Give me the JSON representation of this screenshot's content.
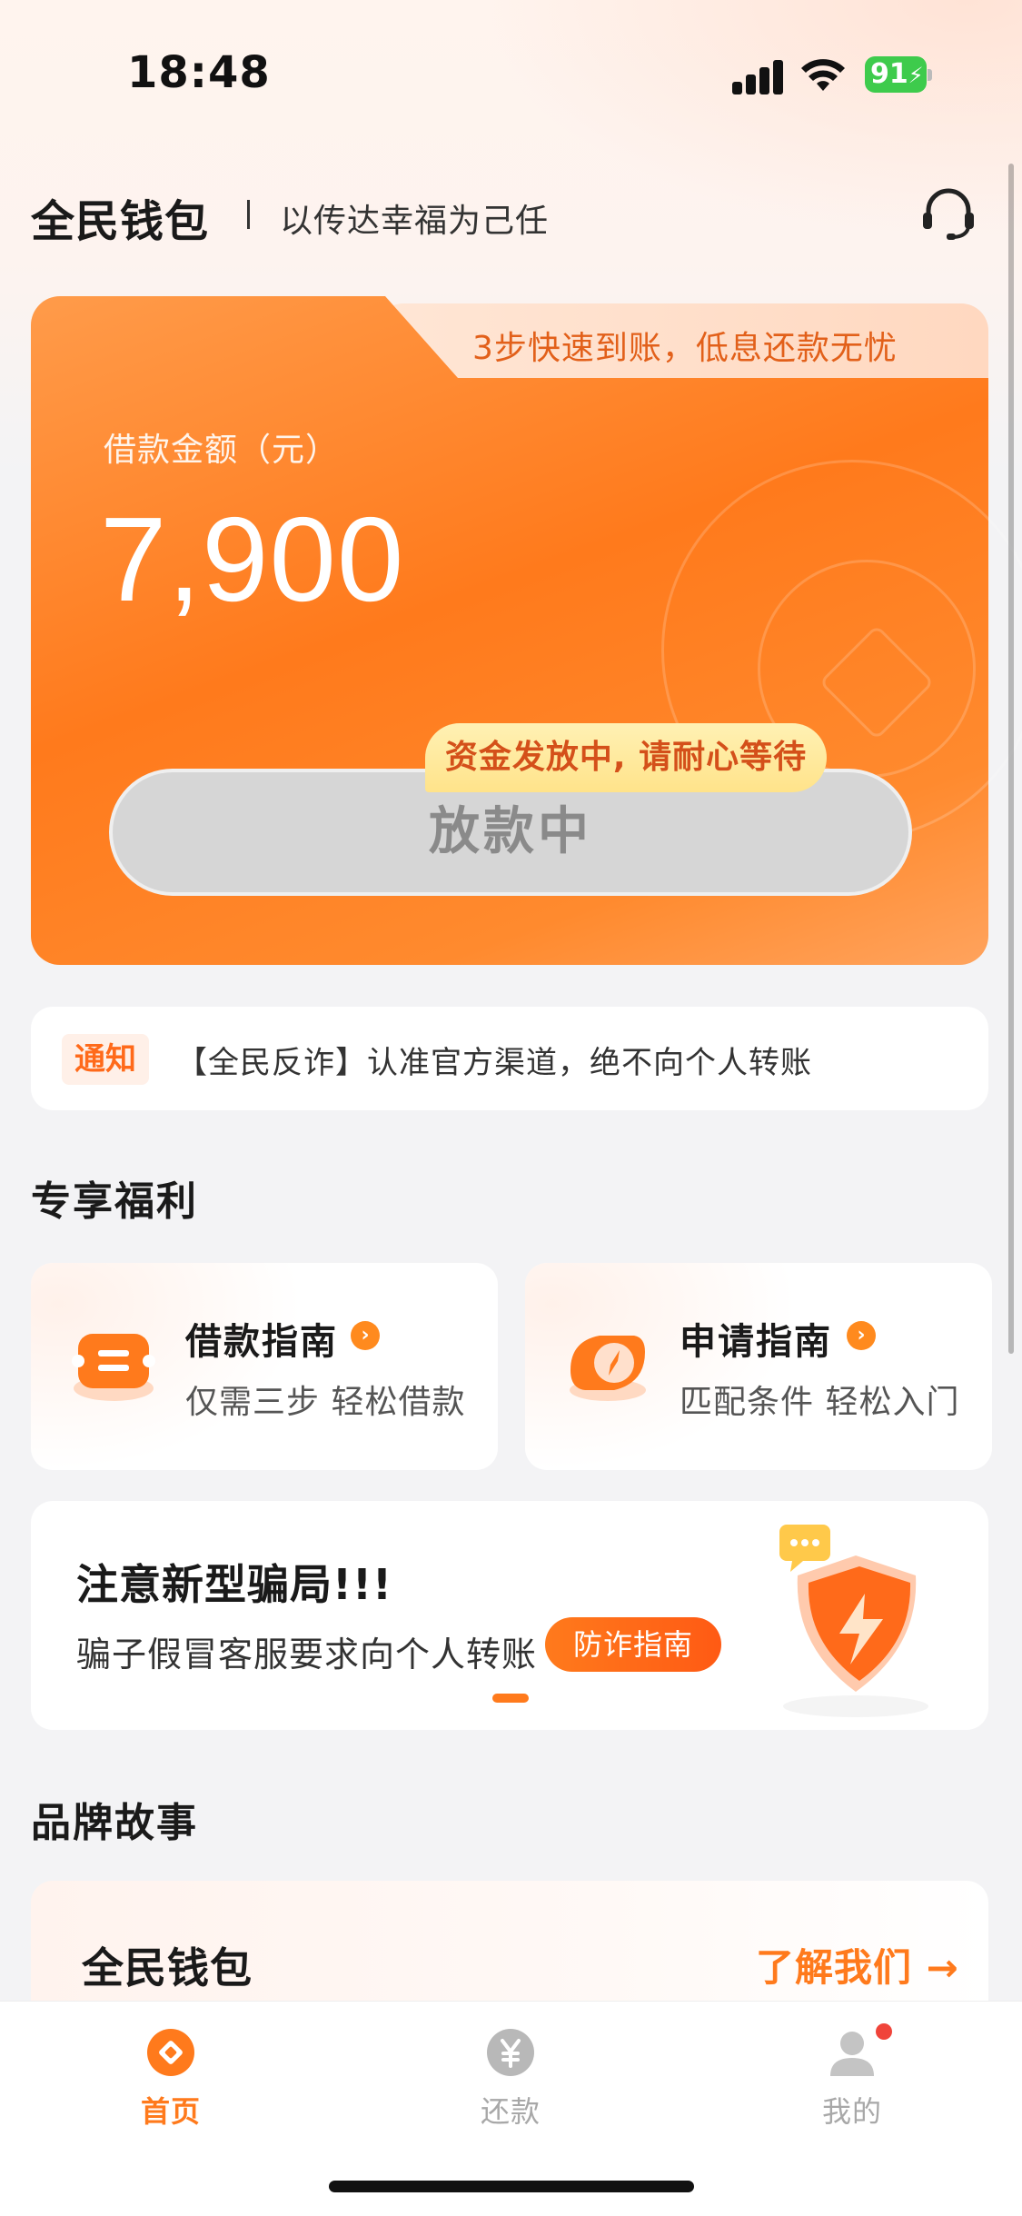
{
  "status_bar": {
    "time": "18:48",
    "battery": "91"
  },
  "header": {
    "brand": "全民钱包",
    "slogan": "以传达幸福为己任"
  },
  "loan_card": {
    "tagline": "3步快速到账，低息还款无忧",
    "amount_label": "借款金额（元）",
    "amount_value": "7,900",
    "status_tip": "资金发放中, 请耐心等待",
    "status_button": "放款中"
  },
  "notice": {
    "tag": "通知",
    "text": "【全民反诈】认准官方渠道，绝不向个人转账"
  },
  "benefits": {
    "title": "专享福利",
    "items": [
      {
        "title": "借款指南",
        "subtitle": "仅需三步  轻松借款"
      },
      {
        "title": "申请指南",
        "subtitle": "匹配条件  轻松入门"
      }
    ]
  },
  "banner": {
    "title": "注意新型骗局!!!",
    "subtitle": "骗子假冒客服要求向个人转账",
    "button": "防诈指南"
  },
  "brand_story": {
    "title": "品牌故事",
    "card_title": "全民钱包",
    "card_link": "了解我们 →"
  },
  "tab_bar": {
    "items": [
      {
        "label": "首页"
      },
      {
        "label": "还款"
      },
      {
        "label": "我的"
      }
    ]
  },
  "colors": {
    "accent": "#ff7a1c",
    "tab_active": "#ff7a1c",
    "tab_inactive": "#a8a8a8"
  }
}
